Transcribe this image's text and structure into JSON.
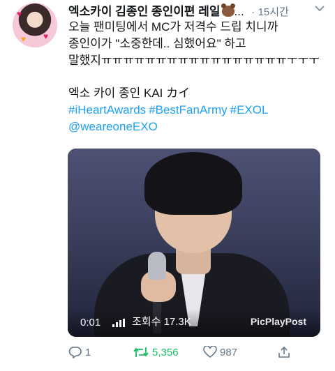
{
  "tweet": {
    "display_name": "엑소카이 김종인 종인이편 레일",
    "name_suffix": "...",
    "separator": "·",
    "time": "15시간",
    "lines": [
      "오늘 팬미팅에서 MC가 저격수 드립 치니까",
      "종인이가 \"소중한데.. 심했어요\" 하고",
      "말했지ㅠㅠㅠㅠㅠㅠㅠㅠㅠㅠㅠㅠㅠㅠㅠㅠㅠㅜㅜㅜ",
      "엑소 카이 종인 KAI カイ"
    ],
    "hashtags": [
      "#iHeartAwards",
      "#BestFanArmy",
      "#EXOL"
    ],
    "mention": "@weareoneEXO"
  },
  "media": {
    "duration": "0:01",
    "views": "조회수 17.3K",
    "watermark": "PicPlayPost"
  },
  "actions": {
    "reply_count": "1",
    "retweet_count": "5,356",
    "like_count": "987"
  },
  "colors": {
    "link": "#1da1f2",
    "retweet": "#17bf63",
    "muted": "#657786"
  }
}
